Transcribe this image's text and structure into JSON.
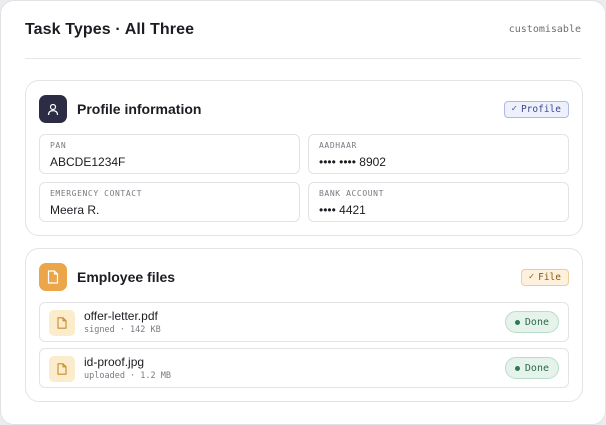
{
  "header": {
    "title": "Task Types · All Three",
    "tag": "customisable"
  },
  "profile": {
    "title": "Profile information",
    "icon": "user-icon",
    "badge": {
      "check": "✓",
      "label": "Profile"
    },
    "fields": [
      {
        "label": "PAN",
        "value": "ABCDE1234F"
      },
      {
        "label": "AADHAAR",
        "value": "•••• •••• 8902"
      },
      {
        "label": "EMERGENCY CONTACT",
        "value": "Meera R."
      },
      {
        "label": "BANK ACCOUNT",
        "value": "•••• 4421"
      }
    ]
  },
  "files": {
    "title": "Employee files",
    "icon": "document-icon",
    "badge": {
      "check": "✓",
      "label": "File"
    },
    "items": [
      {
        "name": "offer-letter.pdf",
        "meta": "signed · 142 KB",
        "status": "Done"
      },
      {
        "name": "id-proof.jpg",
        "meta": "uploaded · 1.2 MB",
        "status": "Done"
      }
    ]
  },
  "colors": {
    "profile_icon_bg": "#2c2c44",
    "files_icon_bg": "#eba64a",
    "status_green": "#2d7a52"
  }
}
